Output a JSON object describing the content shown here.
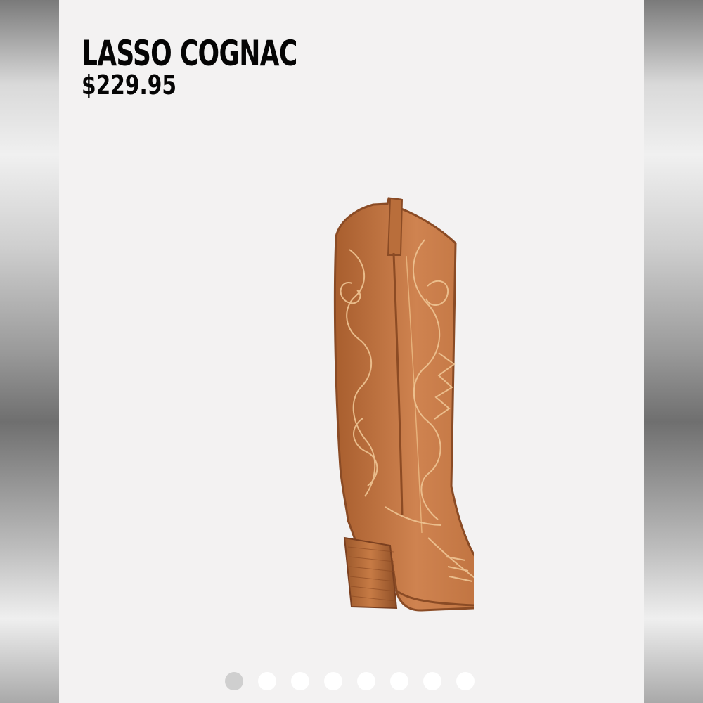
{
  "product": {
    "name": "LASSO COGNAC",
    "price": "$229.95",
    "image_icon": "boot-image"
  },
  "carousel": {
    "total_slides": 8,
    "active_slide": 1
  },
  "colors": {
    "background": "#f3f2f2",
    "text": "#050505",
    "boot": "#c87a45",
    "active_dot": "#cfcfcf",
    "inactive_dot": "#ffffff"
  }
}
